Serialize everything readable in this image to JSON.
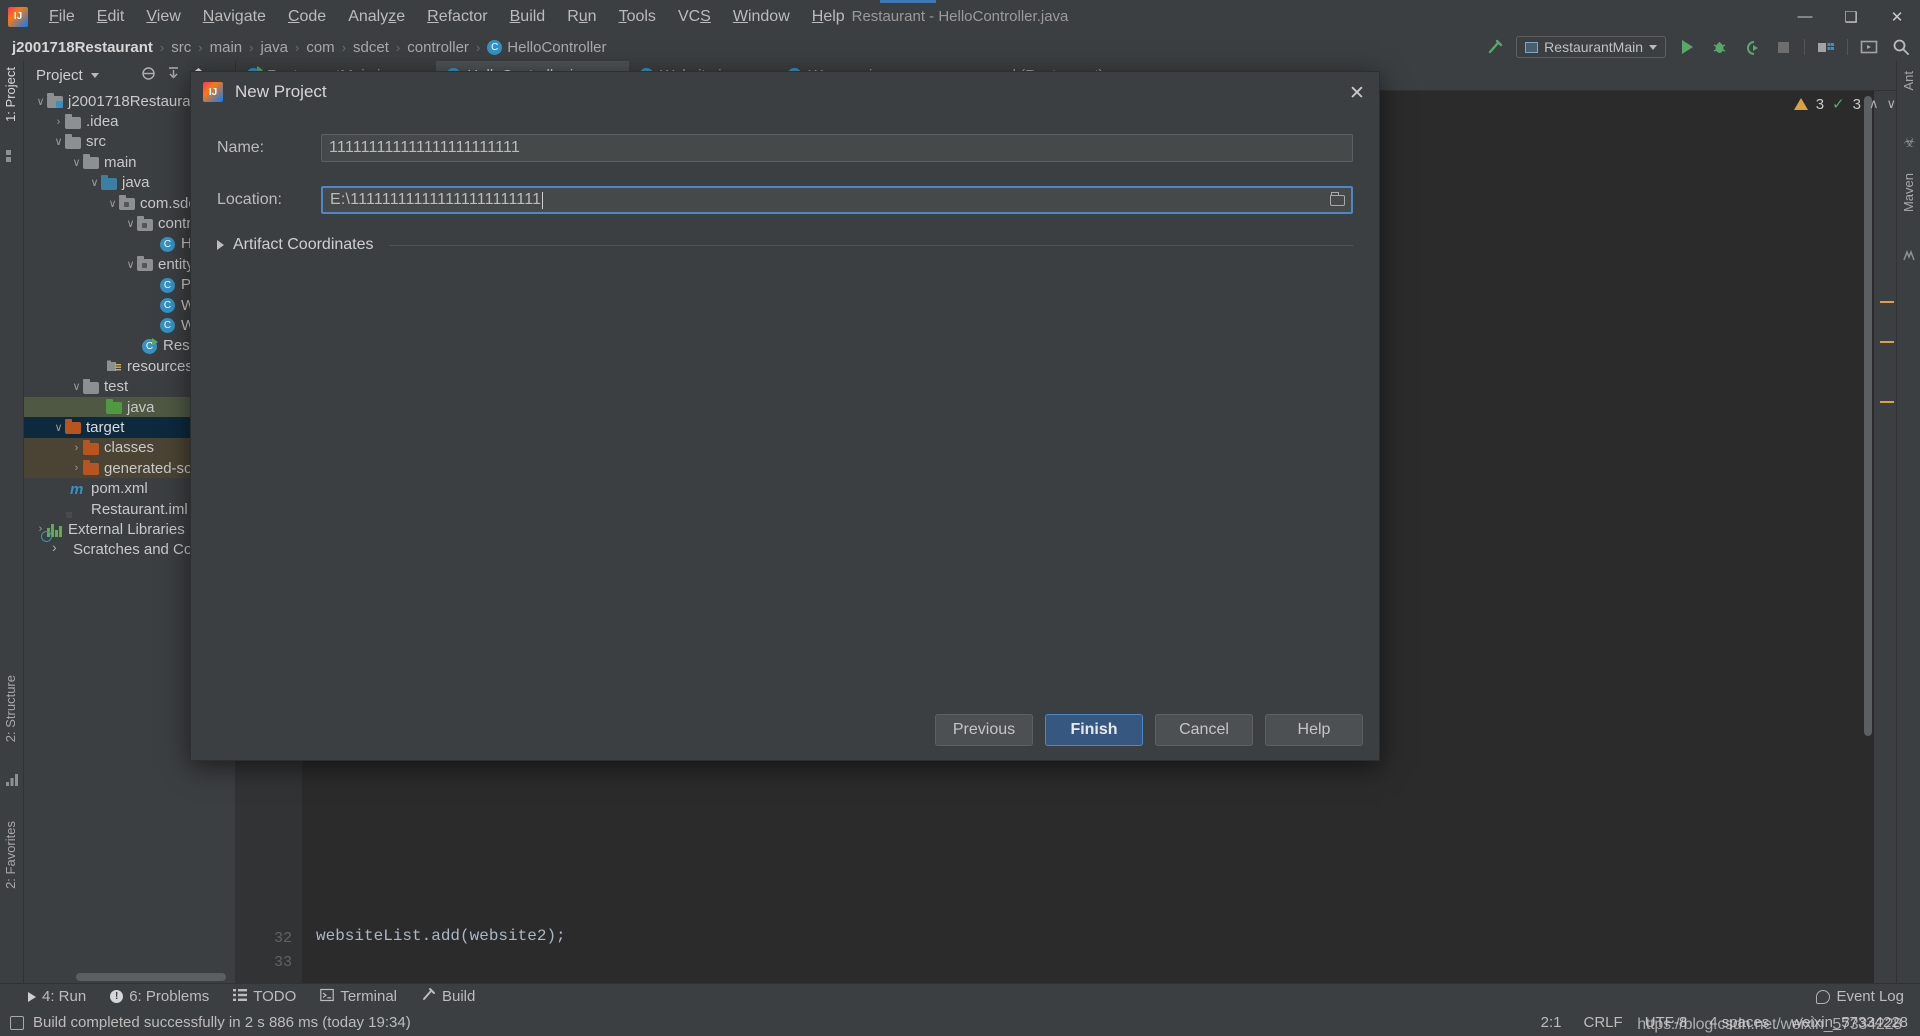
{
  "window": {
    "title": "Restaurant - HelloController.java",
    "logo_text": "IJ",
    "minimize": "—",
    "maximize": "❑",
    "close": "✕"
  },
  "menu": {
    "items": [
      {
        "label": "File"
      },
      {
        "label": "Edit"
      },
      {
        "label": "View"
      },
      {
        "label": "Navigate"
      },
      {
        "label": "Code"
      },
      {
        "label": "Analyze"
      },
      {
        "label": "Refactor"
      },
      {
        "label": "Build"
      },
      {
        "label": "Run"
      },
      {
        "label": "Tools"
      },
      {
        "label": "VCS"
      },
      {
        "label": "Window"
      },
      {
        "label": "Help"
      }
    ]
  },
  "breadcrumb": {
    "items": [
      "j2001718Restaurant",
      "src",
      "main",
      "java",
      "com",
      "sdcet",
      "controller",
      "HelloController"
    ],
    "separator": "›",
    "class_badge": "C"
  },
  "toolbar": {
    "build_icon": "hammer-icon",
    "run_config": "RestaurantMain",
    "run_label": "Run",
    "debug_label": "Debug",
    "coverage_label": "Run with Coverage",
    "stop_label": "Stop",
    "project_structure_label": "Project Structure",
    "layout_label": "Layout",
    "search_label": "Search Everywhere",
    "search_glyph": "⌕"
  },
  "project_panel": {
    "title": "Project",
    "tools": [
      "⊙",
      "⤓",
      "⌂",
      "—"
    ],
    "tree": [
      {
        "label": "j2001718Restaurant",
        "depth": 0,
        "arrow": "∨",
        "icon": "folder-module",
        "state": "normal"
      },
      {
        "label": ".idea",
        "depth": 1,
        "arrow": "›",
        "icon": "folder-grey",
        "state": "normal"
      },
      {
        "label": "src",
        "depth": 1,
        "arrow": "∨",
        "icon": "folder-grey",
        "state": "normal"
      },
      {
        "label": "main",
        "depth": 2,
        "arrow": "∨",
        "icon": "folder-grey",
        "state": "normal"
      },
      {
        "label": "java",
        "depth": 3,
        "arrow": "∨",
        "icon": "folder-blue",
        "state": "normal"
      },
      {
        "label": "com.sdc",
        "depth": 4,
        "arrow": "∨",
        "icon": "folder-package",
        "state": "normal"
      },
      {
        "label": "contr",
        "depth": 5,
        "arrow": "∨",
        "icon": "folder-package",
        "state": "normal"
      },
      {
        "label": "H…",
        "depth": 6,
        "arrow": "",
        "icon": "class",
        "state": "normal"
      },
      {
        "label": "entity",
        "depth": 5,
        "arrow": "∨",
        "icon": "folder-package",
        "state": "normal"
      },
      {
        "label": "Ph",
        "depth": 6,
        "arrow": "",
        "icon": "class",
        "state": "normal"
      },
      {
        "label": "W",
        "depth": 6,
        "arrow": "",
        "icon": "class",
        "state": "normal"
      },
      {
        "label": "W",
        "depth": 6,
        "arrow": "",
        "icon": "class",
        "state": "normal"
      },
      {
        "label": "Resta",
        "depth": 5,
        "arrow": "",
        "icon": "class-runnable",
        "state": "normal"
      },
      {
        "label": "resources",
        "depth": 3,
        "arrow": "",
        "icon": "folder-resources",
        "state": "normal"
      },
      {
        "label": "test",
        "depth": 2,
        "arrow": "∨",
        "icon": "folder-grey",
        "state": "normal"
      },
      {
        "label": "java",
        "depth": 3,
        "arrow": "",
        "icon": "folder-green",
        "state": "selected-green"
      },
      {
        "label": "target",
        "depth": 1,
        "arrow": "∨",
        "icon": "folder-orange",
        "state": "selected-blue"
      },
      {
        "label": "classes",
        "depth": 2,
        "arrow": "›",
        "icon": "folder-orange",
        "state": "highlight"
      },
      {
        "label": "generated-sou",
        "depth": 2,
        "arrow": "›",
        "icon": "folder-orange",
        "state": "highlight"
      },
      {
        "label": "pom.xml",
        "depth": 1,
        "arrow": "",
        "icon": "maven",
        "state": "normal"
      },
      {
        "label": "Restaurant.iml",
        "depth": 1,
        "arrow": "",
        "icon": "iml",
        "state": "normal"
      },
      {
        "label": "External Libraries",
        "depth": 0,
        "arrow": "›",
        "icon": "library",
        "state": "normal"
      },
      {
        "label": "Scratches and Conso",
        "depth": 0,
        "arrow": "",
        "icon": "scratches",
        "state": "normal"
      }
    ]
  },
  "left_strip": {
    "tabs": [
      "1: Project",
      "2: Structure",
      "2: Favorites"
    ],
    "star_glyph": "★"
  },
  "right_strip": {
    "tabs": [
      "Ant",
      "Maven"
    ],
    "bug_glyph": "☣"
  },
  "editor_tabs": [
    {
      "label": "RestaurantMain.java",
      "icon": "class-runnable",
      "active": false,
      "close": "✕"
    },
    {
      "label": "HelloController.java",
      "icon": "class",
      "active": true,
      "close": "✕"
    },
    {
      "label": "Website.java",
      "icon": "class",
      "active": false,
      "close": "✕"
    },
    {
      "label": "Wrapper.java",
      "icon": "class",
      "active": false,
      "close": "✕"
    },
    {
      "label": "pom.xml (Restaurant)",
      "icon": "maven",
      "active": false,
      "close": "✕"
    }
  ],
  "inspection": {
    "warning_count": "3",
    "error_count": "3",
    "up_glyph": "∧",
    "down_glyph": "∨"
  },
  "editor": {
    "lines": [
      {
        "number": "32",
        "text": "websiteList.add(website2);"
      },
      {
        "number": "33",
        "text": ""
      }
    ]
  },
  "dialog": {
    "title": "New Project",
    "logo_text": "IJ",
    "close_glyph": "✕",
    "name_label": "Name:",
    "name_value": "111111111111111111111111",
    "location_label": "Location:",
    "location_value": "E:\\111111111111111111111111",
    "browse_icon": "folder-browse-icon",
    "artifact_label": "Artifact Coordinates",
    "artifact_expanded": false,
    "buttons": {
      "previous": "Previous",
      "finish": "Finish",
      "cancel": "Cancel",
      "help": "Help"
    }
  },
  "bottom_bar": {
    "items": [
      {
        "label": "4: Run",
        "mnemonic": "4",
        "icon": "run-icon"
      },
      {
        "label": "6: Problems",
        "mnemonic": "6",
        "icon": "problems-icon"
      },
      {
        "label": "TODO",
        "mnemonic": "",
        "icon": "todo-icon"
      },
      {
        "label": "Terminal",
        "mnemonic": "",
        "icon": "terminal-icon"
      },
      {
        "label": "Build",
        "mnemonic": "",
        "icon": "build-icon"
      }
    ],
    "event_log": "Event Log"
  },
  "status_bar": {
    "message": "Build completed successfully in 2 s 886 ms (today 19:34)",
    "caret_position": "2:1",
    "line_separator": "CRLF",
    "encoding": "UTF-8",
    "indent": "4 spaces",
    "branch": "weixin_57334228",
    "watermark": "https://blog.csdn.net/weixin_57334228"
  },
  "colors": {
    "background": "#3c3f41",
    "editor_background": "#2b2b2b",
    "accent_blue": "#4a88c7",
    "primary_button": "#365880",
    "selection_blue": "#0d293e",
    "selection_green": "#4e5842",
    "warning": "#d9a343",
    "success": "#59a869"
  }
}
